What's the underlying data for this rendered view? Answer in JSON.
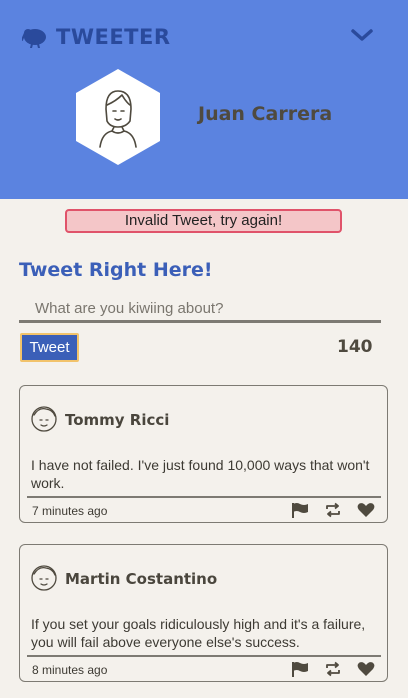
{
  "nav": {
    "brand": "TWEETER",
    "logo_icon": "kiwi-bird-icon",
    "toggle_icon": "chevron-down-icon"
  },
  "profile": {
    "name": "Juan Carrera",
    "avatar_icon": "user-avatar-icon"
  },
  "alert": {
    "text": "Invalid Tweet, try again!"
  },
  "compose": {
    "title": "Tweet Right Here!",
    "placeholder": "What are you kiwiing about?",
    "button_label": "Tweet",
    "counter": "140"
  },
  "tweets": [
    {
      "author": "Tommy Ricci",
      "text": "I have not failed. I've just found 10,000 ways that won't work.",
      "time": "7 minutes ago"
    },
    {
      "author": "Martin Costantino",
      "text": "If you set your goals ridiculously high and it's a failure, you will fail above everyone else's success.",
      "time": "8 minutes ago"
    }
  ],
  "colors": {
    "header": "#5b83e0",
    "brand": "#2a4a9c",
    "accent": "#3b5fb8",
    "error_bg": "#f4c6c8",
    "error_border": "#e0536a",
    "page_bg": "#f4f1ec"
  }
}
